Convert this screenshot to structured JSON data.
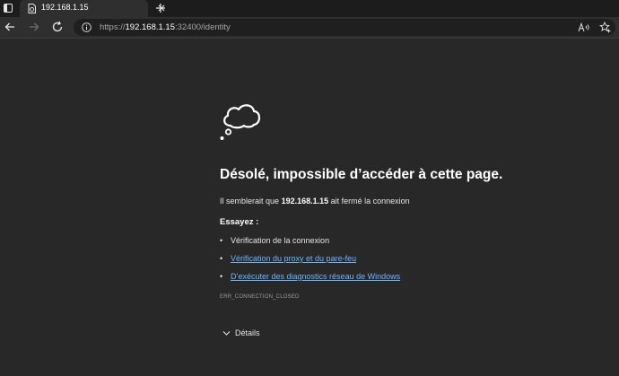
{
  "tab": {
    "title": "192.168.1.15",
    "icon": "page-error-icon"
  },
  "toolbar": {
    "url_prefix": "https://",
    "url_host": "192.168.1.15",
    "url_rest": ":32400/identity"
  },
  "error_page": {
    "headline": "Désolé, impossible d’accéder à cette page.",
    "explain_before": "Il semblerait que",
    "explain_host": "192.168.1.15",
    "explain_after": "ait fermé la connexion",
    "try_heading": "Essayez :",
    "suggestions": [
      "Vérification de la connexion",
      "Vérification du proxy et du pare-feu",
      "D’exécuter des diagnostics réseau de Windows"
    ],
    "error_code": "ERR_CONNECTION_CLOSED",
    "details_label": "Détails"
  },
  "colors": {
    "background": "#282828",
    "link": "#6cb6ff"
  }
}
